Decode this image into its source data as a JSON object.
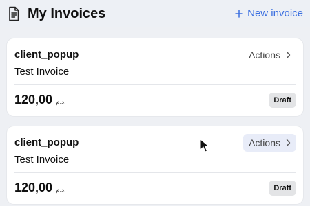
{
  "header": {
    "title": "My Invoices",
    "new_invoice_label": "New invoice",
    "title_icon": "document-icon",
    "new_icon": "plus-icon"
  },
  "invoices": [
    {
      "client": "client_popup",
      "actions_label": "Actions",
      "title": "Test Invoice",
      "amount": "120,00",
      "currency": "د.م.",
      "status": "Draft"
    },
    {
      "client": "client_popup",
      "actions_label": "Actions",
      "title": "Test Invoice",
      "amount": "120,00",
      "currency": "د.م.",
      "status": "Draft"
    }
  ],
  "colors": {
    "background": "#eef0f4",
    "card": "#ffffff",
    "accent": "#3b6fe0",
    "badge": "#e3e4e6",
    "hovered_actions": "#e8ecf8"
  }
}
